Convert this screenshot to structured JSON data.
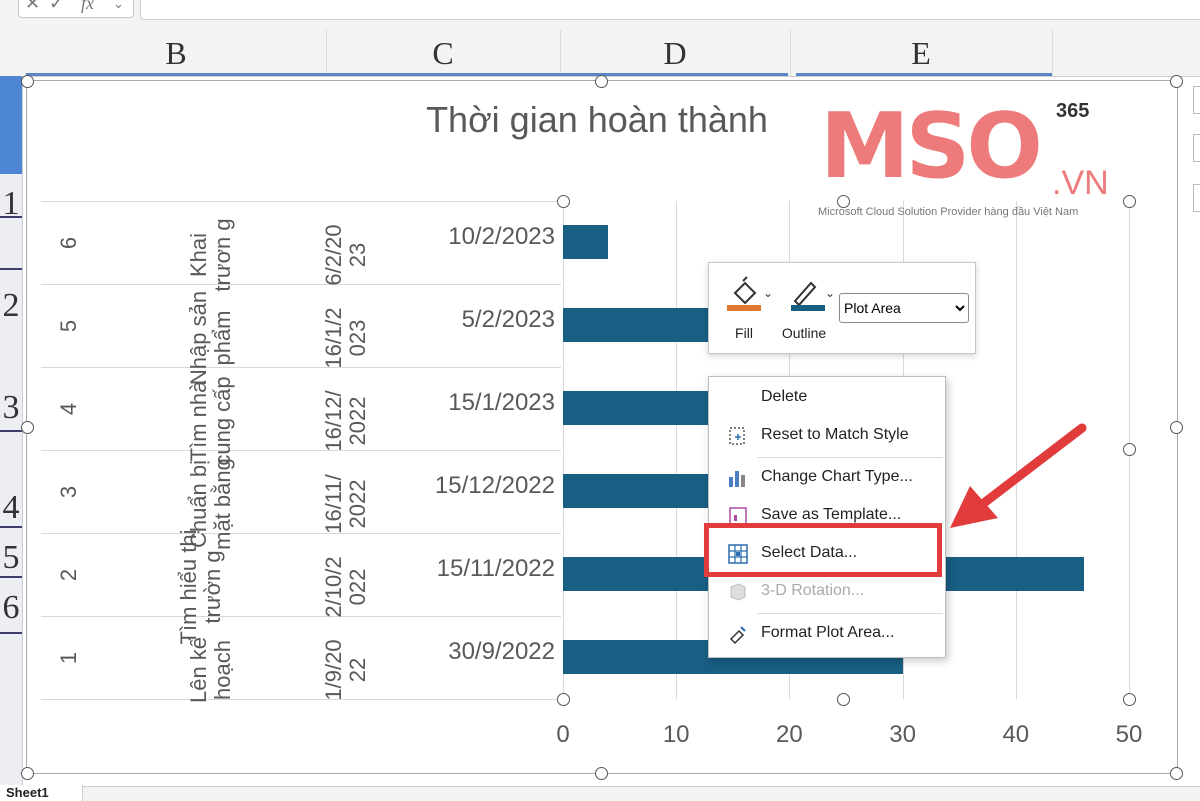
{
  "formula_bar": {
    "fx_label": "fx"
  },
  "columns": [
    "B",
    "C",
    "D",
    "E"
  ],
  "rows": [
    "1",
    "2",
    "3",
    "4",
    "5",
    "6"
  ],
  "sheet_tab": "Sheet1",
  "chart": {
    "title": "Thời gian hoàn thành",
    "rows": [
      {
        "index": "6",
        "task": "Khai trươn g",
        "start_date": "6/2/20 23",
        "end_date": "10/2/2023"
      },
      {
        "index": "5",
        "task": "Nhập sản phẩm",
        "start_date": "16/1/2 023",
        "end_date": "5/2/2023"
      },
      {
        "index": "4",
        "task": "Tìm nhà cung cấp",
        "start_date": "16/12/ 2022",
        "end_date": "15/1/2023"
      },
      {
        "index": "3",
        "task": "Chuẩn bị mặt bằng",
        "start_date": "16/11/ 2022",
        "end_date": "15/12/2022"
      },
      {
        "index": "2",
        "task": "Tìm hiểu thị trườn g",
        "start_date": "2/10/2 022",
        "end_date": "15/11/2022"
      },
      {
        "index": "1",
        "task": "Lên kế hoạch",
        "start_date": "1/9/20 22",
        "end_date": "30/9/2022"
      }
    ],
    "x_ticks": [
      "0",
      "10",
      "20",
      "30",
      "40",
      "50"
    ]
  },
  "chart_data": {
    "type": "bar",
    "orientation": "horizontal",
    "title": "Thời gian hoàn thành",
    "categories": [
      "6",
      "5",
      "4",
      "3",
      "2",
      "1"
    ],
    "values": [
      4,
      20,
      30,
      29,
      46,
      30
    ],
    "xlim": [
      0,
      50
    ],
    "grid": true,
    "color": "#195e83"
  },
  "format_toolbar": {
    "fill_label": "Fill",
    "outline_label": "Outline",
    "selected_element": "Plot Area",
    "fill_color": "#e07a2e",
    "outline_color": "#195e83"
  },
  "context_menu": {
    "items": [
      {
        "label": "Delete",
        "icon": "none",
        "enabled": true
      },
      {
        "label": "Reset to Match Style",
        "icon": "reset-style-icon",
        "enabled": true
      },
      {
        "label": "Change Chart Type...",
        "icon": "chart-type-icon",
        "enabled": true
      },
      {
        "label": "Save as Template...",
        "icon": "template-icon",
        "enabled": true
      },
      {
        "label": "Select Data...",
        "icon": "select-data-icon",
        "enabled": true
      },
      {
        "label": "3-D Rotation...",
        "icon": "rotation-icon",
        "enabled": false
      },
      {
        "label": "Format Plot Area...",
        "icon": "format-plot-icon",
        "enabled": true
      }
    ]
  },
  "logo": {
    "brand": "MSO",
    "superscript": "365",
    "domain": ".VN",
    "tagline": "Microsoft Cloud Solution Provider hàng đầu Việt Nam"
  },
  "annotation": {
    "highlight_color": "#e23b3b"
  }
}
